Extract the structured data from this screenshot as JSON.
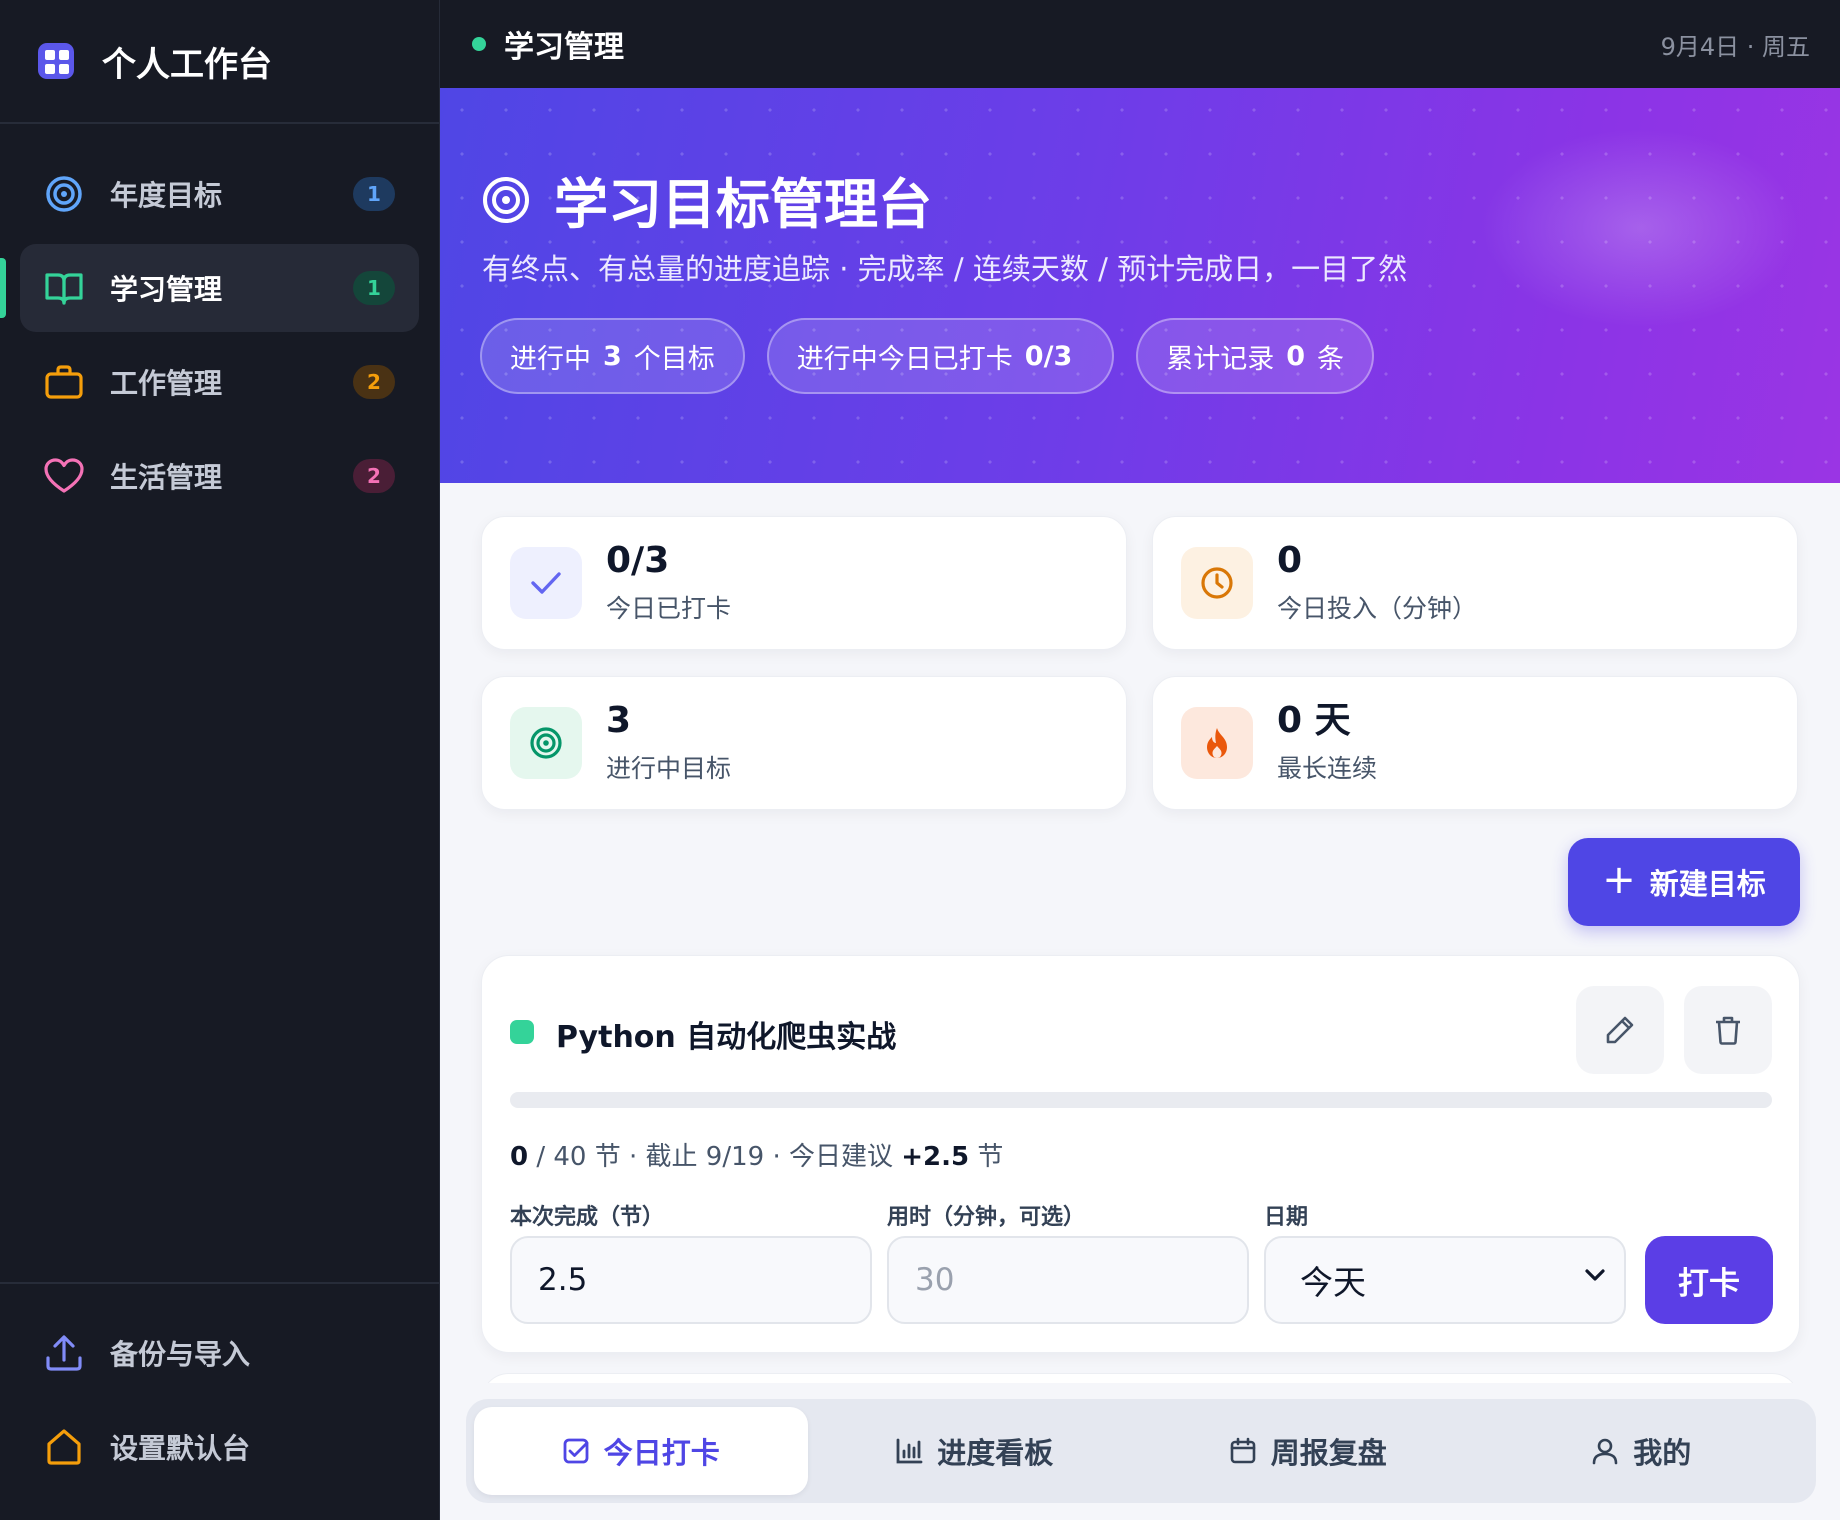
{
  "sidebar": {
    "brand": "个人工作台",
    "items": [
      {
        "label": "年度目标",
        "badge": "1",
        "icon": "target-icon"
      },
      {
        "label": "学习管理",
        "badge": "1",
        "icon": "book-icon",
        "active": true
      },
      {
        "label": "工作管理",
        "badge": "2",
        "icon": "briefcase-icon"
      },
      {
        "label": "生活管理",
        "badge": "2",
        "icon": "heart-icon"
      }
    ],
    "bottom": [
      {
        "label": "备份与导入",
        "icon": "upload-icon"
      },
      {
        "label": "设置默认台",
        "icon": "home-icon"
      }
    ]
  },
  "topbar": {
    "title": "学习管理",
    "date": "9月4日 · 周五"
  },
  "hero": {
    "title": "学习目标管理台",
    "subtitle": "有终点、有总量的进度追踪 · 完成率 / 连续天数 / 预计完成日，一目了然",
    "pills": [
      {
        "prefix": "进行中",
        "value": "3",
        "suffix": "个目标"
      },
      {
        "prefix": "进行中今日已打卡",
        "value": "0/3",
        "suffix": ""
      },
      {
        "prefix": "累计记录",
        "value": "0",
        "suffix": "条"
      }
    ]
  },
  "stats": [
    {
      "value": "0/3",
      "label": "今日已打卡",
      "icon": "check-icon"
    },
    {
      "value": "0",
      "label": "今日投入（分钟）",
      "icon": "clock-icon"
    },
    {
      "value": "3",
      "label": "进行中目标",
      "icon": "target-icon"
    },
    {
      "value": "0 天",
      "label": "最长连续",
      "icon": "flame-icon"
    }
  ],
  "new_goal_label": "新建目标",
  "goal": {
    "title": "Python 自动化爬虫实战",
    "progress_percent": 0,
    "meta_done": "0",
    "meta_rest": " / 40 节 · 截止 9/19 · 今日建议 ",
    "meta_suggest": "+2.5",
    "meta_unit": " 节",
    "field_done_label": "本次完成（节）",
    "field_done_value": "2.5",
    "field_time_label": "用时（分钟，可选）",
    "field_time_placeholder": "30",
    "field_date_label": "日期",
    "field_date_value": "今天",
    "checkin_label": "打卡"
  },
  "tabs": [
    {
      "label": "今日打卡",
      "icon": "checkbox-icon",
      "active": true
    },
    {
      "label": "进度看板",
      "icon": "bar-chart-icon"
    },
    {
      "label": "周报复盘",
      "icon": "calendar-icon"
    },
    {
      "label": "我的",
      "icon": "user-icon"
    }
  ],
  "colors": {
    "accent": "#4f46e5",
    "success": "#34d399",
    "sidebar_bg": "#171a24"
  }
}
